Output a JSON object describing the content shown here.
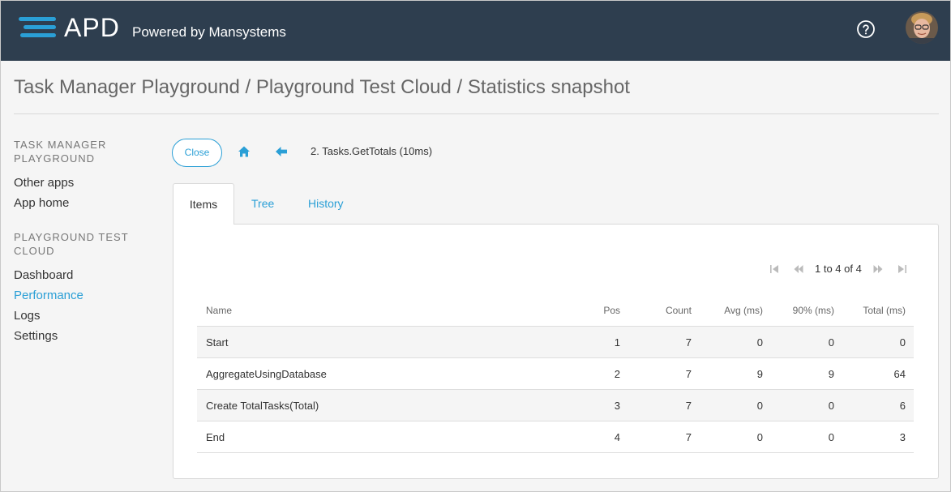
{
  "header": {
    "brand": "APD",
    "powered_by": "Powered by Mansystems",
    "icons": [
      "apd-logo-icon",
      "help-icon",
      "user-avatar"
    ],
    "colors": {
      "topbar": "#2e3e4f",
      "accent": "#2a9fd6"
    }
  },
  "page": {
    "title": "Task Manager Playground / Playground Test Cloud / Statistics snapshot"
  },
  "sidebar": {
    "sections": [
      {
        "heading": "TASK MANAGER PLAYGROUND",
        "items": [
          {
            "label": "Other apps",
            "active": false
          },
          {
            "label": "App home",
            "active": false
          }
        ]
      },
      {
        "heading": "PLAYGROUND TEST CLOUD",
        "items": [
          {
            "label": "Dashboard",
            "active": false
          },
          {
            "label": "Performance",
            "active": true
          },
          {
            "label": "Logs",
            "active": false
          },
          {
            "label": "Settings",
            "active": false
          }
        ]
      }
    ]
  },
  "toolbar": {
    "close_label": "Close",
    "crumb": "2. Tasks.GetTotals (10ms)"
  },
  "tabs": [
    {
      "label": "Items",
      "active": true
    },
    {
      "label": "Tree",
      "active": false
    },
    {
      "label": "History",
      "active": false
    }
  ],
  "pager": {
    "text": "1 to 4 of 4"
  },
  "table": {
    "columns": [
      "Name",
      "Pos",
      "Count",
      "Avg (ms)",
      "90% (ms)",
      "Total (ms)"
    ],
    "rows": [
      {
        "name": "Start",
        "pos": "1",
        "count": "7",
        "avg": "0",
        "p90": "0",
        "total": "0"
      },
      {
        "name": "AggregateUsingDatabase",
        "pos": "2",
        "count": "7",
        "avg": "9",
        "p90": "9",
        "total": "64"
      },
      {
        "name": "Create TotalTasks(Total)",
        "pos": "3",
        "count": "7",
        "avg": "0",
        "p90": "0",
        "total": "6"
      },
      {
        "name": "End",
        "pos": "4",
        "count": "7",
        "avg": "0",
        "p90": "0",
        "total": "3"
      }
    ]
  }
}
